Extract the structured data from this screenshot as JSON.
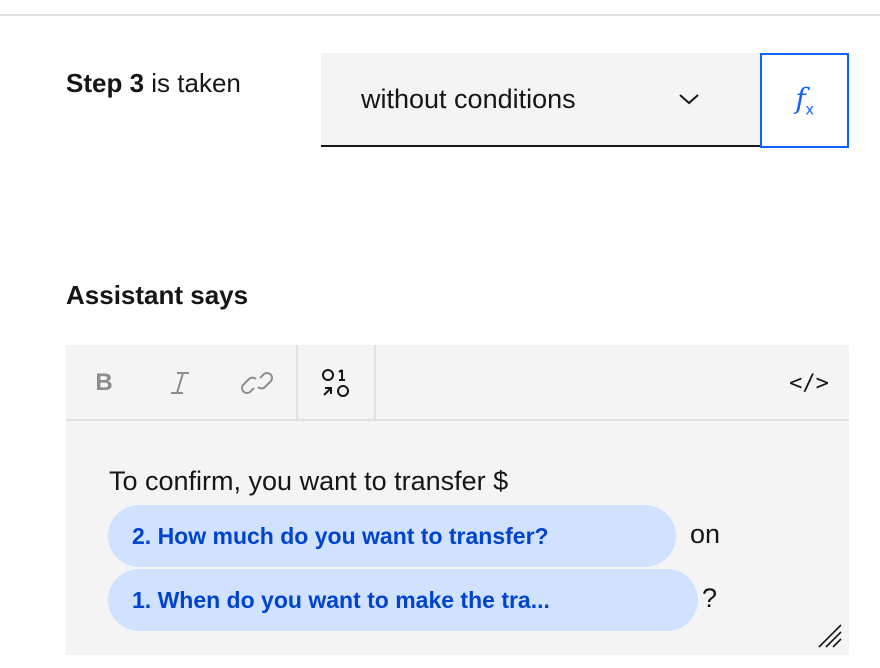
{
  "step": {
    "label_bold": "Step 3",
    "label_rest": " is taken",
    "condition_value": "without conditions",
    "fx_label": "f",
    "fx_sub": "x"
  },
  "assistant": {
    "heading": "Assistant says",
    "toolbar": {
      "bold": "B",
      "code": "</>"
    },
    "message": {
      "text_before": "To confirm, you want to transfer $",
      "chip1": "2. How much do you want to transfer?",
      "text_between": "on",
      "chip2": "1. When do you want to make the tra...",
      "text_after": "?"
    }
  },
  "colors": {
    "accent": "#0f62fe",
    "chip_bg": "#d0e2ff",
    "chip_text": "#0043ce",
    "field_bg": "#f4f4f4"
  }
}
